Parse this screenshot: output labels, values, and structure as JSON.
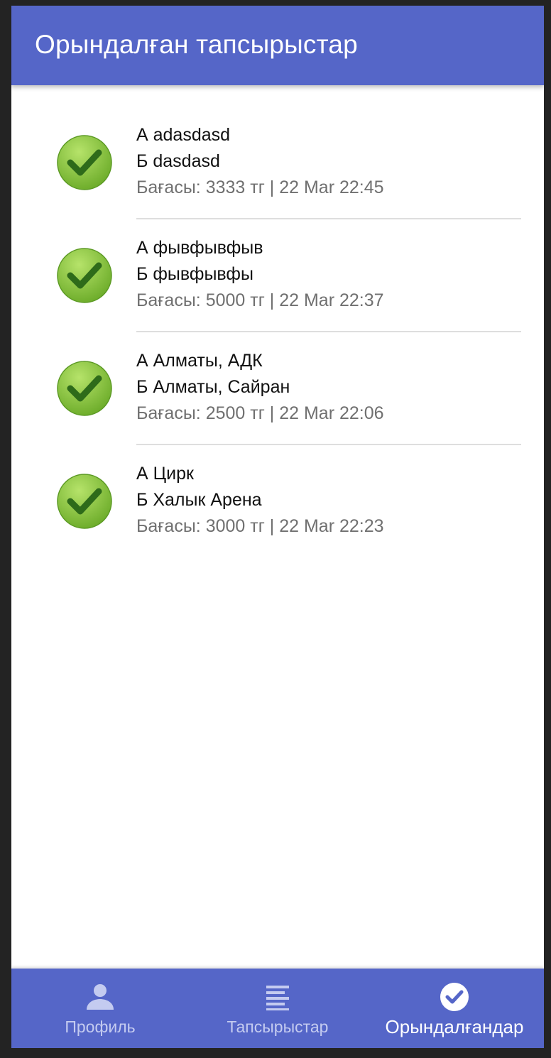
{
  "app_bar": {
    "title": "Орындалған тапсырыстар"
  },
  "orders": [
    {
      "from": "А adasdasd",
      "to": "Б dasdasd",
      "meta": "Бағасы: 3333 тг | 22 Mar 22:45",
      "icon": "check-circle-icon"
    },
    {
      "from": "А фывфывфыв",
      "to": "Б фывфывфы",
      "meta": "Бағасы: 5000 тг | 22 Mar 22:37",
      "icon": "check-circle-icon"
    },
    {
      "from": "А Алматы, АДК",
      "to": "Б Алматы, Сайран",
      "meta": "Бағасы: 2500 тг | 22 Mar 22:06",
      "icon": "check-circle-icon"
    },
    {
      "from": "А Цирк",
      "to": "Б Халык Арена",
      "meta": "Бағасы: 3000 тг | 22 Mar 22:23",
      "icon": "check-circle-icon"
    }
  ],
  "bottom_nav": {
    "items": [
      {
        "label": "Профиль",
        "icon": "person-icon",
        "active": false
      },
      {
        "label": "Тапсырыстар",
        "icon": "list-icon",
        "active": false
      },
      {
        "label": "Орындалғандар",
        "icon": "check-circle-icon",
        "active": true
      }
    ]
  },
  "colors": {
    "primary": "#5566c8",
    "check_green": "#8cc63f",
    "check_dark": "#2e6b1a",
    "nav_inactive": "#c4cbf0"
  }
}
